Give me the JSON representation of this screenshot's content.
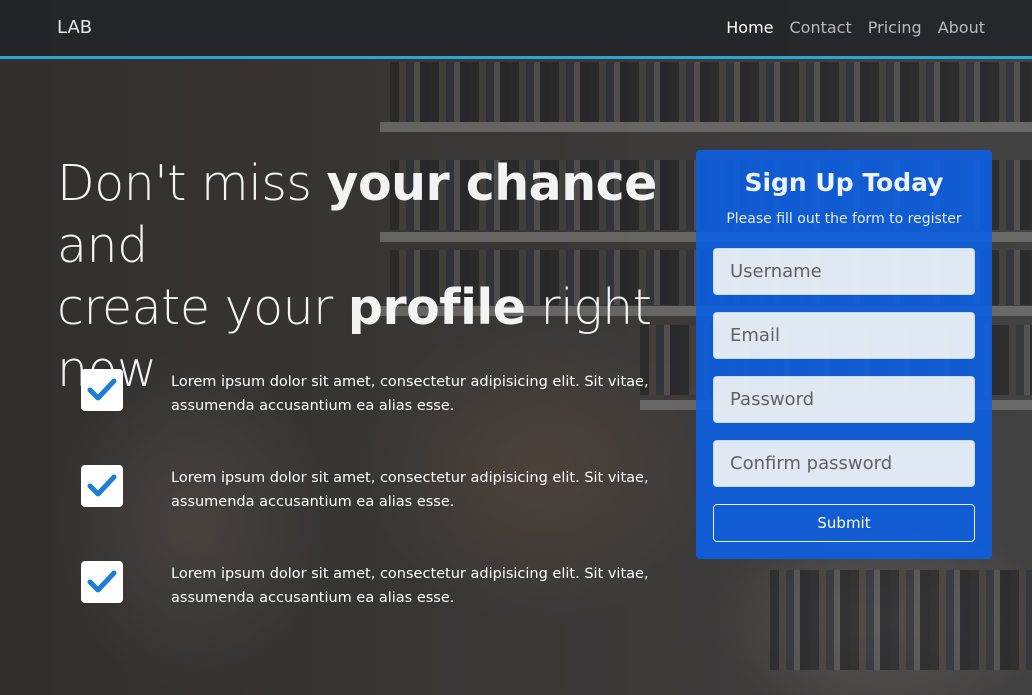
{
  "navbar": {
    "brand": "LAB",
    "links": [
      "Home",
      "Contact",
      "Pricing",
      "About"
    ]
  },
  "hero": {
    "line1_pre": "Don't miss ",
    "line1_bold": "your chance",
    "line1_post": " and",
    "line2_pre": "create your ",
    "line2_bold": "profile",
    "line2_post": " right",
    "line3": "now"
  },
  "features": [
    "Lorem ipsum dolor sit amet, consectetur adipisicing elit. Sit vitae, assumenda accusantium ea alias esse.",
    "Lorem ipsum dolor sit amet, consectetur adipisicing elit. Sit vitae, assumenda accusantium ea alias esse.",
    "Lorem ipsum dolor sit amet, consectetur adipisicing elit. Sit vitae, assumenda accusantium ea alias esse."
  ],
  "form": {
    "title": "Sign Up Today",
    "subtitle": "Please fill out the form to register",
    "username_placeholder": "Username",
    "email_placeholder": "Email",
    "password_placeholder": "Password",
    "confirm_placeholder": "Confirm password",
    "submit_label": "Submit"
  },
  "colors": {
    "accent_line": "#2aa7cf",
    "card_blue": "#0e5fde",
    "check_blue": "#1a7fd0"
  }
}
